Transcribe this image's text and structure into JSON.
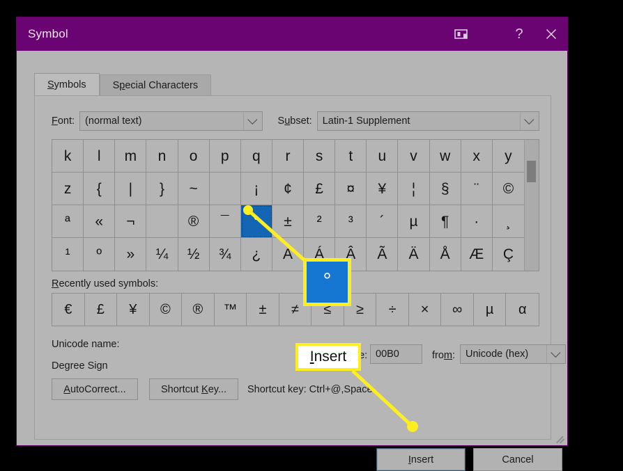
{
  "window": {
    "title": "Symbol",
    "titlebar_icons": [
      {
        "name": "restore-icon",
        "glyph": "restore"
      },
      {
        "name": "help-icon",
        "glyph": "?"
      },
      {
        "name": "close-icon",
        "glyph": "✕"
      }
    ]
  },
  "tabs": [
    {
      "label": "Symbols",
      "accel": "S",
      "active": true
    },
    {
      "label": "Special Characters",
      "accel": "p",
      "active": false
    }
  ],
  "fields": {
    "font_label": "Font:",
    "font_label_accel": "F",
    "font_value": "(normal text)",
    "subset_label": "Subset:",
    "subset_label_accel": "u",
    "subset_value": "Latin-1 Supplement",
    "charcode_label": "Character code:",
    "charcode_label_short": "Cha",
    "charcode_label_accel": "C",
    "charcode_value": "00B0",
    "from_label": "from:",
    "from_label_accel": "m",
    "from_value": "Unicode (hex)"
  },
  "grid": {
    "selected_index": 36,
    "cells": [
      "k",
      "l",
      "m",
      "n",
      "o",
      "p",
      "q",
      "r",
      "s",
      "t",
      "u",
      "v",
      "w",
      "x",
      "y",
      "z",
      "{",
      "|",
      "}",
      "~",
      "",
      "¡",
      "¢",
      "£",
      "¤",
      "¥",
      "¦",
      "§",
      "¨",
      "©",
      "ª",
      "«",
      "¬",
      "­",
      "®",
      "¯",
      "°",
      "±",
      "²",
      "³",
      "´",
      "µ",
      "¶",
      "·",
      "¸",
      "¹",
      "º",
      "»",
      "¼",
      "½",
      "¾",
      "¿",
      "À",
      "Á",
      "Â",
      "Ã",
      "Ä",
      "Å",
      "Æ",
      "Ç"
    ]
  },
  "recent": {
    "label": "Recently used symbols:",
    "label_accel": "R",
    "cells": [
      "€",
      "£",
      "¥",
      "©",
      "®",
      "™",
      "±",
      "≠",
      "≤",
      "≥",
      "÷",
      "×",
      "∞",
      "µ",
      "α"
    ]
  },
  "unicode": {
    "name_label": "Unicode name:",
    "name_value": "Degree Sign"
  },
  "buttons": {
    "autocorrect": "AutoCorrect...",
    "autocorrect_accel": "A",
    "shortcut_key": "Shortcut Key...",
    "shortcut_key_accel": "K",
    "insert": "Insert",
    "insert_accel": "I",
    "cancel": "Cancel"
  },
  "status": {
    "shortcut_text": "Shortcut key: Ctrl+@,Space"
  },
  "annotations": {
    "zoom_symbol_glyph": "°",
    "zoom_insert_label": "Insert",
    "zoom_insert_accel": "I",
    "highlight_color": "#fcee21",
    "selection_color": "#1565b5",
    "titlebar_color": "#6b0473"
  }
}
